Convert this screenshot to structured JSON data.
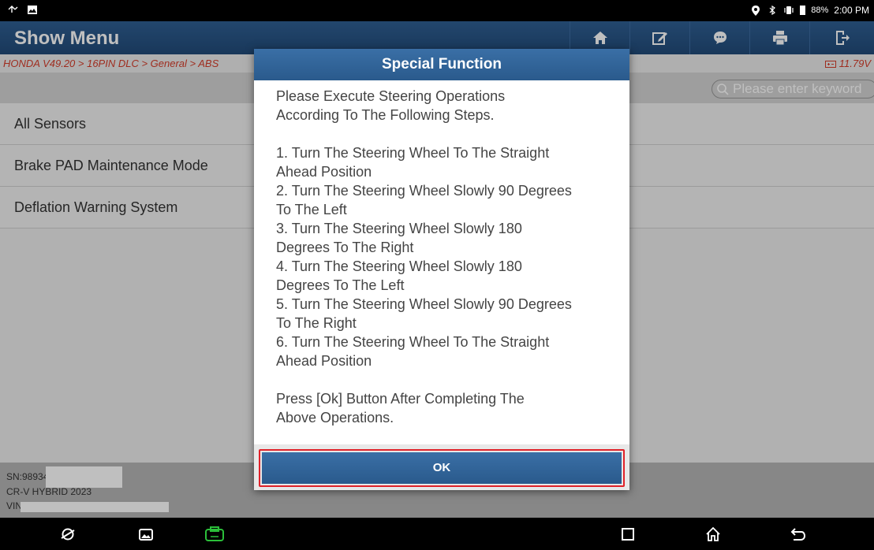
{
  "status_bar": {
    "battery": "88%",
    "time": "2:00 PM"
  },
  "header": {
    "title": "Show Menu",
    "icons": [
      "home-icon",
      "edit-icon",
      "chat-icon",
      "print-icon",
      "exit-icon"
    ]
  },
  "breadcrumb": {
    "path": "HONDA V49.20 > 16PIN DLC > General > ABS",
    "voltage": "11.79V"
  },
  "search": {
    "placeholder": "Please enter keyword"
  },
  "menu": {
    "items": [
      {
        "label": "All Sensors"
      },
      {
        "label": "Brake PAD Maintenance Mode"
      },
      {
        "label": "Deflation Warning System"
      }
    ]
  },
  "info": {
    "sn": "SN:98934",
    "vehicle": "CR-V HYBRID 2023",
    "vin": "VIN"
  },
  "dialog": {
    "title": "Special Function",
    "body": "Please Execute Steering Operations\nAccording To The Following Steps.\n\n1. Turn The Steering Wheel To The Straight\nAhead Position\n2. Turn The Steering Wheel Slowly 90 Degrees\nTo The Left\n3. Turn The Steering Wheel Slowly 180\nDegrees To The Right\n4. Turn The Steering Wheel Slowly 180\nDegrees To The Left\n5. Turn The Steering Wheel Slowly 90 Degrees\nTo The Right\n6. Turn The Steering Wheel To The Straight\nAhead Position\n\nPress [Ok] Button After Completing The\nAbove Operations.",
    "ok_label": "OK"
  },
  "colors": {
    "header_blue": "#2a5a8c",
    "breadcrumb_red": "#d43c2a",
    "highlight_red": "#e0222a",
    "vci_green": "#2bbf3a"
  }
}
